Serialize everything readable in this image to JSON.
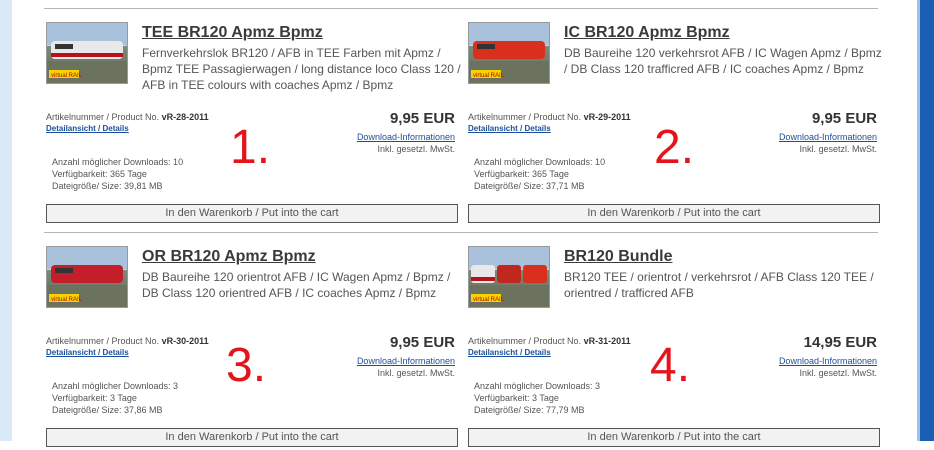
{
  "labels": {
    "artnum_prefix": "Artikelnummer / Product No.",
    "details": "Detailansicht / Details",
    "download_info": "Download-Informationen",
    "tax": "Inkl. gesetzl. MwSt.",
    "cart": "In den Warenkorb / Put into the cart"
  },
  "products": [
    {
      "title": "TEE BR120 Apmz Bpmz",
      "desc": "Fernverkehrslok BR120 / AFB in TEE Farben mit Apmz / Bpmz TEE Passagierwagen / long distance loco Class 120 / AFB in TEE colours with coaches Apmz / Bpmz",
      "sku": "vR-28-2011",
      "price": "9,95 EUR",
      "downloads": "Anzahl möglicher Downloads: 10",
      "availability": "Verfügbarkeit: 365 Tage",
      "size": "Dateigröße/ Size: 39,81 MB",
      "number": "1.",
      "thumb_color": "#e8e8e8"
    },
    {
      "title": "IC BR120 Apmz Bpmz",
      "desc": "DB Baureihe 120 verkehrsrot AFB / IC Wagen Apmz / Bpmz / DB Class 120 trafficred AFB / IC coaches Apmz / Bpmz",
      "sku": "vR-29-2011",
      "price": "9,95 EUR",
      "downloads": "Anzahl möglicher Downloads: 10",
      "availability": "Verfügbarkeit: 365 Tage",
      "size": "Dateigröße/ Size: 37,71 MB",
      "number": "2.",
      "thumb_color": "#d8301c"
    },
    {
      "title": "OR BR120 Apmz Bpmz",
      "desc": "DB Baureihe 120 orientrot AFB / IC Wagen Apmz / Bpmz / DB Class 120 orientred AFB / IC coaches Apmz / Bpmz",
      "sku": "vR-30-2011",
      "price": "9,95 EUR",
      "downloads": "Anzahl möglicher Downloads: 3",
      "availability": "Verfügbarkeit: 3 Tage",
      "size": "Dateigröße/ Size: 37,86 MB",
      "number": "3.",
      "thumb_color": "#c41e2a"
    },
    {
      "title": "BR120 Bundle",
      "desc": "BR120 TEE / orientrot / verkehrsrot / AFB Class 120 TEE / orientred / trafficred AFB",
      "sku": "vR-31-2011",
      "price": "14,95 EUR",
      "downloads": "Anzahl möglicher Downloads: 3",
      "availability": "Verfügbarkeit: 3 Tage",
      "size": "Dateigröße/ Size: 77,79 MB",
      "number": "4.",
      "thumb_color": "#c0281e"
    }
  ]
}
